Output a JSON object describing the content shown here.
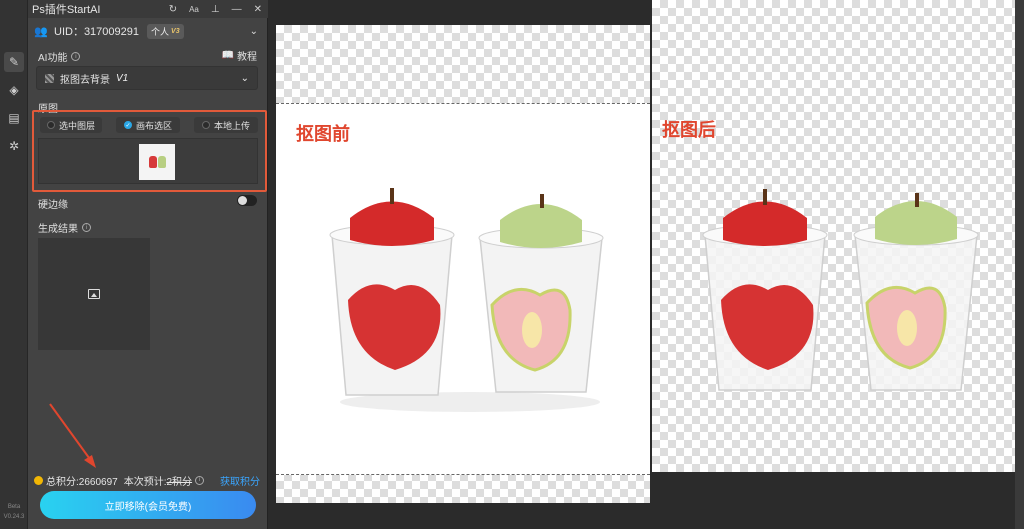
{
  "panel": {
    "title": "Ps插件StartAI",
    "title_icons": [
      "refresh-icon",
      "Aa",
      "pin-icon",
      "minimize-icon",
      "close-icon"
    ],
    "font_icon_text": "Aa",
    "uid_label": "UID：317009291",
    "plan_badge": "个人",
    "plan_level": "V3",
    "ai_function_label": "AI功能",
    "tutorial_label": "教程",
    "selected_function": "抠图去背景",
    "function_version": "V1",
    "image_section_label": "原图",
    "modes": [
      {
        "label": "选中图层",
        "checked": false
      },
      {
        "label": "画布选区",
        "checked": true
      },
      {
        "label": "本地上传",
        "checked": false
      }
    ],
    "hard_edge_label": "硬边缘",
    "hard_edge_on": false,
    "result_label": "生成结果",
    "total_points": "总积分:2660697",
    "estimate_label": "本次预计:",
    "estimate_value": "2积分",
    "get_points": "获取积分",
    "main_button": "立即移除(会员免费)",
    "beta_label": "Beta",
    "version_label": "V0.24.3"
  },
  "canvas": {
    "before_label": "抠图前",
    "after_label": "抠图后"
  },
  "colors": {
    "accent_red": "#e0462e",
    "highlight_border": "#e25a3a",
    "link_blue": "#3aa6ff",
    "button_gradient_start": "#29d2f0",
    "button_gradient_end": "#3a8af0",
    "checked_blue": "#2aa7e6"
  }
}
